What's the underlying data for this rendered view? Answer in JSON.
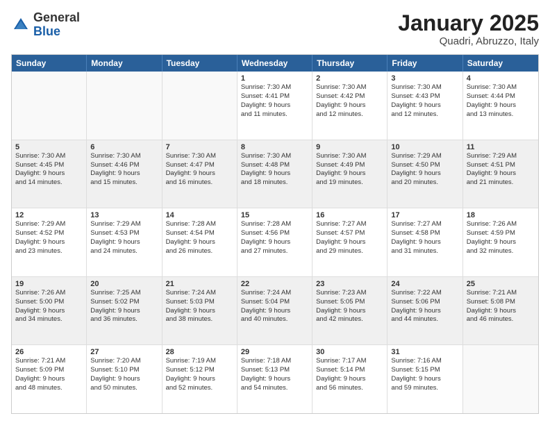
{
  "header": {
    "logo_general": "General",
    "logo_blue": "Blue",
    "month_title": "January 2025",
    "location": "Quadri, Abruzzo, Italy"
  },
  "weekdays": [
    "Sunday",
    "Monday",
    "Tuesday",
    "Wednesday",
    "Thursday",
    "Friday",
    "Saturday"
  ],
  "rows": [
    {
      "shaded": false,
      "cells": [
        {
          "day": "",
          "lines": [],
          "empty": true
        },
        {
          "day": "",
          "lines": [],
          "empty": true
        },
        {
          "day": "",
          "lines": [],
          "empty": true
        },
        {
          "day": "1",
          "lines": [
            "Sunrise: 7:30 AM",
            "Sunset: 4:41 PM",
            "Daylight: 9 hours",
            "and 11 minutes."
          ],
          "empty": false
        },
        {
          "day": "2",
          "lines": [
            "Sunrise: 7:30 AM",
            "Sunset: 4:42 PM",
            "Daylight: 9 hours",
            "and 12 minutes."
          ],
          "empty": false
        },
        {
          "day": "3",
          "lines": [
            "Sunrise: 7:30 AM",
            "Sunset: 4:43 PM",
            "Daylight: 9 hours",
            "and 12 minutes."
          ],
          "empty": false
        },
        {
          "day": "4",
          "lines": [
            "Sunrise: 7:30 AM",
            "Sunset: 4:44 PM",
            "Daylight: 9 hours",
            "and 13 minutes."
          ],
          "empty": false
        }
      ]
    },
    {
      "shaded": true,
      "cells": [
        {
          "day": "5",
          "lines": [
            "Sunrise: 7:30 AM",
            "Sunset: 4:45 PM",
            "Daylight: 9 hours",
            "and 14 minutes."
          ],
          "empty": false
        },
        {
          "day": "6",
          "lines": [
            "Sunrise: 7:30 AM",
            "Sunset: 4:46 PM",
            "Daylight: 9 hours",
            "and 15 minutes."
          ],
          "empty": false
        },
        {
          "day": "7",
          "lines": [
            "Sunrise: 7:30 AM",
            "Sunset: 4:47 PM",
            "Daylight: 9 hours",
            "and 16 minutes."
          ],
          "empty": false
        },
        {
          "day": "8",
          "lines": [
            "Sunrise: 7:30 AM",
            "Sunset: 4:48 PM",
            "Daylight: 9 hours",
            "and 18 minutes."
          ],
          "empty": false
        },
        {
          "day": "9",
          "lines": [
            "Sunrise: 7:30 AM",
            "Sunset: 4:49 PM",
            "Daylight: 9 hours",
            "and 19 minutes."
          ],
          "empty": false
        },
        {
          "day": "10",
          "lines": [
            "Sunrise: 7:29 AM",
            "Sunset: 4:50 PM",
            "Daylight: 9 hours",
            "and 20 minutes."
          ],
          "empty": false
        },
        {
          "day": "11",
          "lines": [
            "Sunrise: 7:29 AM",
            "Sunset: 4:51 PM",
            "Daylight: 9 hours",
            "and 21 minutes."
          ],
          "empty": false
        }
      ]
    },
    {
      "shaded": false,
      "cells": [
        {
          "day": "12",
          "lines": [
            "Sunrise: 7:29 AM",
            "Sunset: 4:52 PM",
            "Daylight: 9 hours",
            "and 23 minutes."
          ],
          "empty": false
        },
        {
          "day": "13",
          "lines": [
            "Sunrise: 7:29 AM",
            "Sunset: 4:53 PM",
            "Daylight: 9 hours",
            "and 24 minutes."
          ],
          "empty": false
        },
        {
          "day": "14",
          "lines": [
            "Sunrise: 7:28 AM",
            "Sunset: 4:54 PM",
            "Daylight: 9 hours",
            "and 26 minutes."
          ],
          "empty": false
        },
        {
          "day": "15",
          "lines": [
            "Sunrise: 7:28 AM",
            "Sunset: 4:56 PM",
            "Daylight: 9 hours",
            "and 27 minutes."
          ],
          "empty": false
        },
        {
          "day": "16",
          "lines": [
            "Sunrise: 7:27 AM",
            "Sunset: 4:57 PM",
            "Daylight: 9 hours",
            "and 29 minutes."
          ],
          "empty": false
        },
        {
          "day": "17",
          "lines": [
            "Sunrise: 7:27 AM",
            "Sunset: 4:58 PM",
            "Daylight: 9 hours",
            "and 31 minutes."
          ],
          "empty": false
        },
        {
          "day": "18",
          "lines": [
            "Sunrise: 7:26 AM",
            "Sunset: 4:59 PM",
            "Daylight: 9 hours",
            "and 32 minutes."
          ],
          "empty": false
        }
      ]
    },
    {
      "shaded": true,
      "cells": [
        {
          "day": "19",
          "lines": [
            "Sunrise: 7:26 AM",
            "Sunset: 5:00 PM",
            "Daylight: 9 hours",
            "and 34 minutes."
          ],
          "empty": false
        },
        {
          "day": "20",
          "lines": [
            "Sunrise: 7:25 AM",
            "Sunset: 5:02 PM",
            "Daylight: 9 hours",
            "and 36 minutes."
          ],
          "empty": false
        },
        {
          "day": "21",
          "lines": [
            "Sunrise: 7:24 AM",
            "Sunset: 5:03 PM",
            "Daylight: 9 hours",
            "and 38 minutes."
          ],
          "empty": false
        },
        {
          "day": "22",
          "lines": [
            "Sunrise: 7:24 AM",
            "Sunset: 5:04 PM",
            "Daylight: 9 hours",
            "and 40 minutes."
          ],
          "empty": false
        },
        {
          "day": "23",
          "lines": [
            "Sunrise: 7:23 AM",
            "Sunset: 5:05 PM",
            "Daylight: 9 hours",
            "and 42 minutes."
          ],
          "empty": false
        },
        {
          "day": "24",
          "lines": [
            "Sunrise: 7:22 AM",
            "Sunset: 5:06 PM",
            "Daylight: 9 hours",
            "and 44 minutes."
          ],
          "empty": false
        },
        {
          "day": "25",
          "lines": [
            "Sunrise: 7:21 AM",
            "Sunset: 5:08 PM",
            "Daylight: 9 hours",
            "and 46 minutes."
          ],
          "empty": false
        }
      ]
    },
    {
      "shaded": false,
      "cells": [
        {
          "day": "26",
          "lines": [
            "Sunrise: 7:21 AM",
            "Sunset: 5:09 PM",
            "Daylight: 9 hours",
            "and 48 minutes."
          ],
          "empty": false
        },
        {
          "day": "27",
          "lines": [
            "Sunrise: 7:20 AM",
            "Sunset: 5:10 PM",
            "Daylight: 9 hours",
            "and 50 minutes."
          ],
          "empty": false
        },
        {
          "day": "28",
          "lines": [
            "Sunrise: 7:19 AM",
            "Sunset: 5:12 PM",
            "Daylight: 9 hours",
            "and 52 minutes."
          ],
          "empty": false
        },
        {
          "day": "29",
          "lines": [
            "Sunrise: 7:18 AM",
            "Sunset: 5:13 PM",
            "Daylight: 9 hours",
            "and 54 minutes."
          ],
          "empty": false
        },
        {
          "day": "30",
          "lines": [
            "Sunrise: 7:17 AM",
            "Sunset: 5:14 PM",
            "Daylight: 9 hours",
            "and 56 minutes."
          ],
          "empty": false
        },
        {
          "day": "31",
          "lines": [
            "Sunrise: 7:16 AM",
            "Sunset: 5:15 PM",
            "Daylight: 9 hours",
            "and 59 minutes."
          ],
          "empty": false
        },
        {
          "day": "",
          "lines": [],
          "empty": true
        }
      ]
    }
  ]
}
